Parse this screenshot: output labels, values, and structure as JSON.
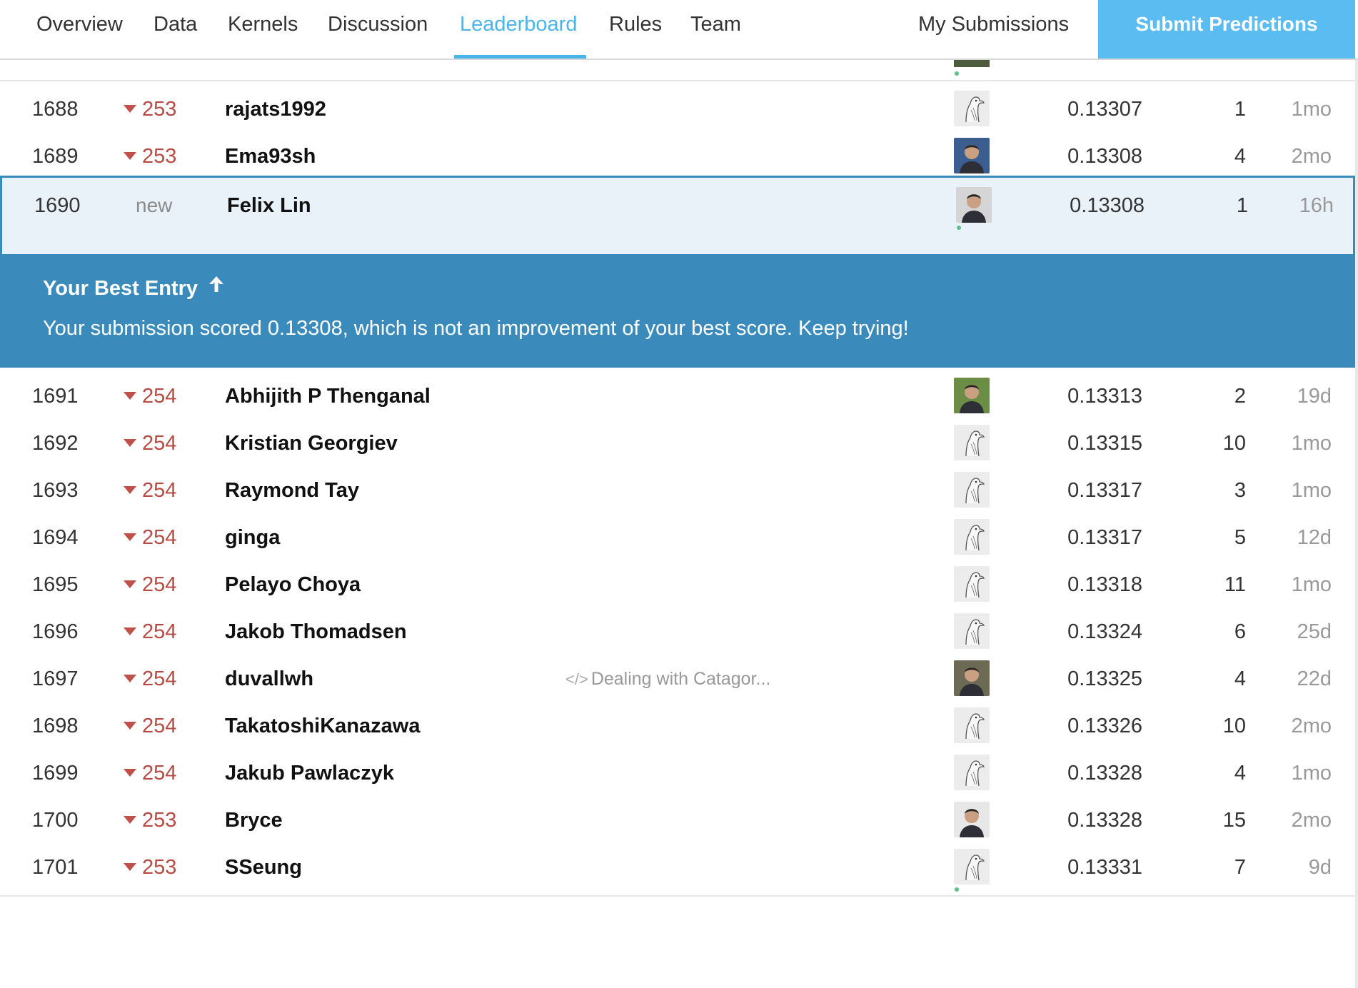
{
  "nav": {
    "tabs": [
      {
        "label": "Overview"
      },
      {
        "label": "Data"
      },
      {
        "label": "Kernels"
      },
      {
        "label": "Discussion"
      },
      {
        "label": "Leaderboard"
      },
      {
        "label": "Rules"
      },
      {
        "label": "Team"
      }
    ],
    "active_tab": "Leaderboard",
    "my_submissions": "My Submissions",
    "submit_button": "Submit Predictions"
  },
  "colors": {
    "accent": "#4bb4e8",
    "submit_bg": "#5bbcf1",
    "banner_bg": "#3a8bbb",
    "rank_drop": "#b84a44",
    "tier_novice": "#5cc08a",
    "tier_contributor": "#4ba3d9"
  },
  "rows": [
    {
      "rank": "1688",
      "change": "253",
      "change_type": "down",
      "name": "rajats1992",
      "kernel": "",
      "avatar": "default-bird-icon",
      "tier_dots": 1,
      "tier": "novice",
      "score": "0.13307",
      "entries": "1",
      "last": "1mo"
    },
    {
      "rank": "1689",
      "change": "253",
      "change_type": "down",
      "name": "Ema93sh",
      "kernel": "",
      "avatar": "user-photo",
      "tier_dots": 1,
      "tier": "novice",
      "score": "0.13308",
      "entries": "4",
      "last": "2mo"
    },
    {
      "rank": "1690",
      "change": "new",
      "change_type": "new",
      "name": "Felix Lin",
      "kernel": "",
      "avatar": "user-photo",
      "tier_dots": 1,
      "tier": "novice",
      "score": "0.13308",
      "entries": "1",
      "last": "16h",
      "is_me": true
    },
    {
      "rank": "1691",
      "change": "254",
      "change_type": "down",
      "name": "Abhijith P Thenganal",
      "kernel": "",
      "avatar": "user-photo",
      "tier_dots": 2,
      "tier": "contributor",
      "score": "0.13313",
      "entries": "2",
      "last": "19d"
    },
    {
      "rank": "1692",
      "change": "254",
      "change_type": "down",
      "name": "Kristian Georgiev",
      "kernel": "",
      "avatar": "default-bird-icon",
      "tier_dots": 1,
      "tier": "novice",
      "score": "0.13315",
      "entries": "10",
      "last": "1mo"
    },
    {
      "rank": "1693",
      "change": "254",
      "change_type": "down",
      "name": "Raymond Tay",
      "kernel": "",
      "avatar": "default-bird-icon",
      "tier_dots": 2,
      "tier": "contributor",
      "score": "0.13317",
      "entries": "3",
      "last": "1mo"
    },
    {
      "rank": "1694",
      "change": "254",
      "change_type": "down",
      "name": "ginga",
      "kernel": "",
      "avatar": "default-bird-icon",
      "tier_dots": 1,
      "tier": "novice",
      "score": "0.13317",
      "entries": "5",
      "last": "12d"
    },
    {
      "rank": "1695",
      "change": "254",
      "change_type": "down",
      "name": "Pelayo Choya",
      "kernel": "",
      "avatar": "default-bird-icon",
      "tier_dots": 1,
      "tier": "novice",
      "score": "0.13318",
      "entries": "11",
      "last": "1mo"
    },
    {
      "rank": "1696",
      "change": "254",
      "change_type": "down",
      "name": "Jakob Thomadsen",
      "kernel": "",
      "avatar": "default-bird-icon",
      "tier_dots": 1,
      "tier": "novice",
      "score": "0.13324",
      "entries": "6",
      "last": "25d"
    },
    {
      "rank": "1697",
      "change": "254",
      "change_type": "down",
      "name": "duvallwh",
      "kernel": "Dealing with Catagor...",
      "avatar": "user-photo",
      "tier_dots": 2,
      "tier": "contributor",
      "score": "0.13325",
      "entries": "4",
      "last": "22d"
    },
    {
      "rank": "1698",
      "change": "254",
      "change_type": "down",
      "name": "TakatoshiKanazawa",
      "kernel": "",
      "avatar": "default-bird-icon",
      "tier_dots": 1,
      "tier": "novice",
      "score": "0.13326",
      "entries": "10",
      "last": "2mo"
    },
    {
      "rank": "1699",
      "change": "254",
      "change_type": "down",
      "name": "Jakub Pawlaczyk",
      "kernel": "",
      "avatar": "default-bird-icon",
      "tier_dots": 1,
      "tier": "novice",
      "score": "0.13328",
      "entries": "4",
      "last": "1mo"
    },
    {
      "rank": "1700",
      "change": "253",
      "change_type": "down",
      "name": "Bryce",
      "kernel": "",
      "avatar": "user-photo",
      "tier_dots": 1,
      "tier": "novice",
      "score": "0.13328",
      "entries": "15",
      "last": "2mo"
    },
    {
      "rank": "1701",
      "change": "253",
      "change_type": "down",
      "name": "SSeung",
      "kernel": "",
      "avatar": "default-bird-icon",
      "tier_dots": 1,
      "tier": "novice",
      "score": "0.13331",
      "entries": "7",
      "last": "9d"
    }
  ],
  "banner": {
    "title": "Your Best Entry",
    "message": "Your submission scored 0.13308, which is not an improvement of your best score. Keep trying!"
  }
}
